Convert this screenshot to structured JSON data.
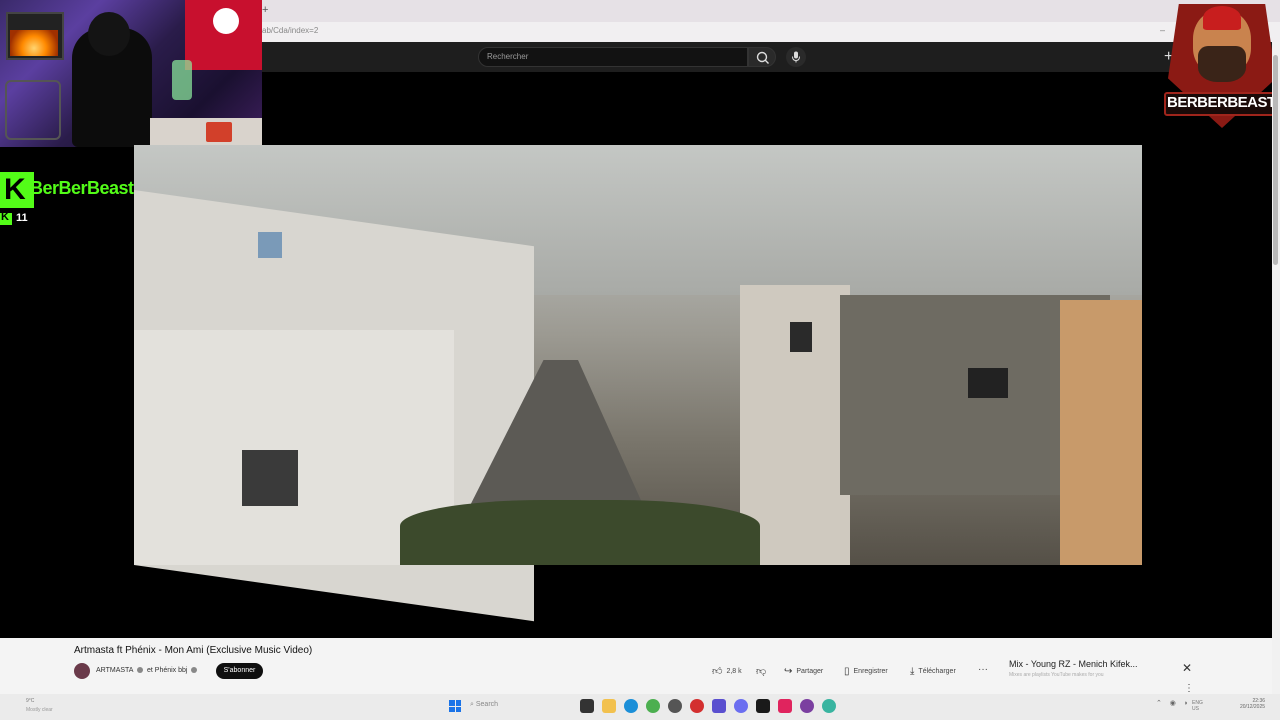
{
  "browser": {
    "new_tab": "+",
    "address_fragment": "ab/Cda/index=2",
    "window_controls": "–  □  ✕"
  },
  "youtube": {
    "search_placeholder": "Rechercher",
    "search_icon": "search-icon",
    "mic_icon": "mic-icon",
    "create_icon": "+"
  },
  "overlay": {
    "kick_channel": "BerBerBeast",
    "kick_letter": "K",
    "viewer_count": "11",
    "brand_name": "BERBERBEAST"
  },
  "video_info": {
    "title": "Artmasta ft Phénix - Mon Ami (Exclusive Music Video)",
    "channel_primary": "ARTMASTA",
    "channel_joiner": "et Phénix bbj",
    "subscribe_label": "S'abonner",
    "likes": "2,8 k",
    "share_label": "Partager",
    "save_label": "Enregistrer",
    "download_label": "Télécharger",
    "more_label": "···"
  },
  "queue": {
    "title": "Mix - Young RZ - Menich Kifek...",
    "subtitle": "Mixes are playlists YouTube makes for you",
    "close_label": "✕",
    "more_label": "⋮"
  },
  "taskbar": {
    "weather_temp": "9°C",
    "weather_desc": "Mostly clear",
    "search_label": "Search",
    "tray": "⌃ ◉ ◗",
    "lang_top": "ENG",
    "lang_bottom": "US",
    "time": "22:36",
    "date": "20/12/2025"
  },
  "colors": {
    "kick_green": "#53fc18",
    "brand_red": "#c81e1e",
    "yt_dark": "#1e1e1e"
  }
}
